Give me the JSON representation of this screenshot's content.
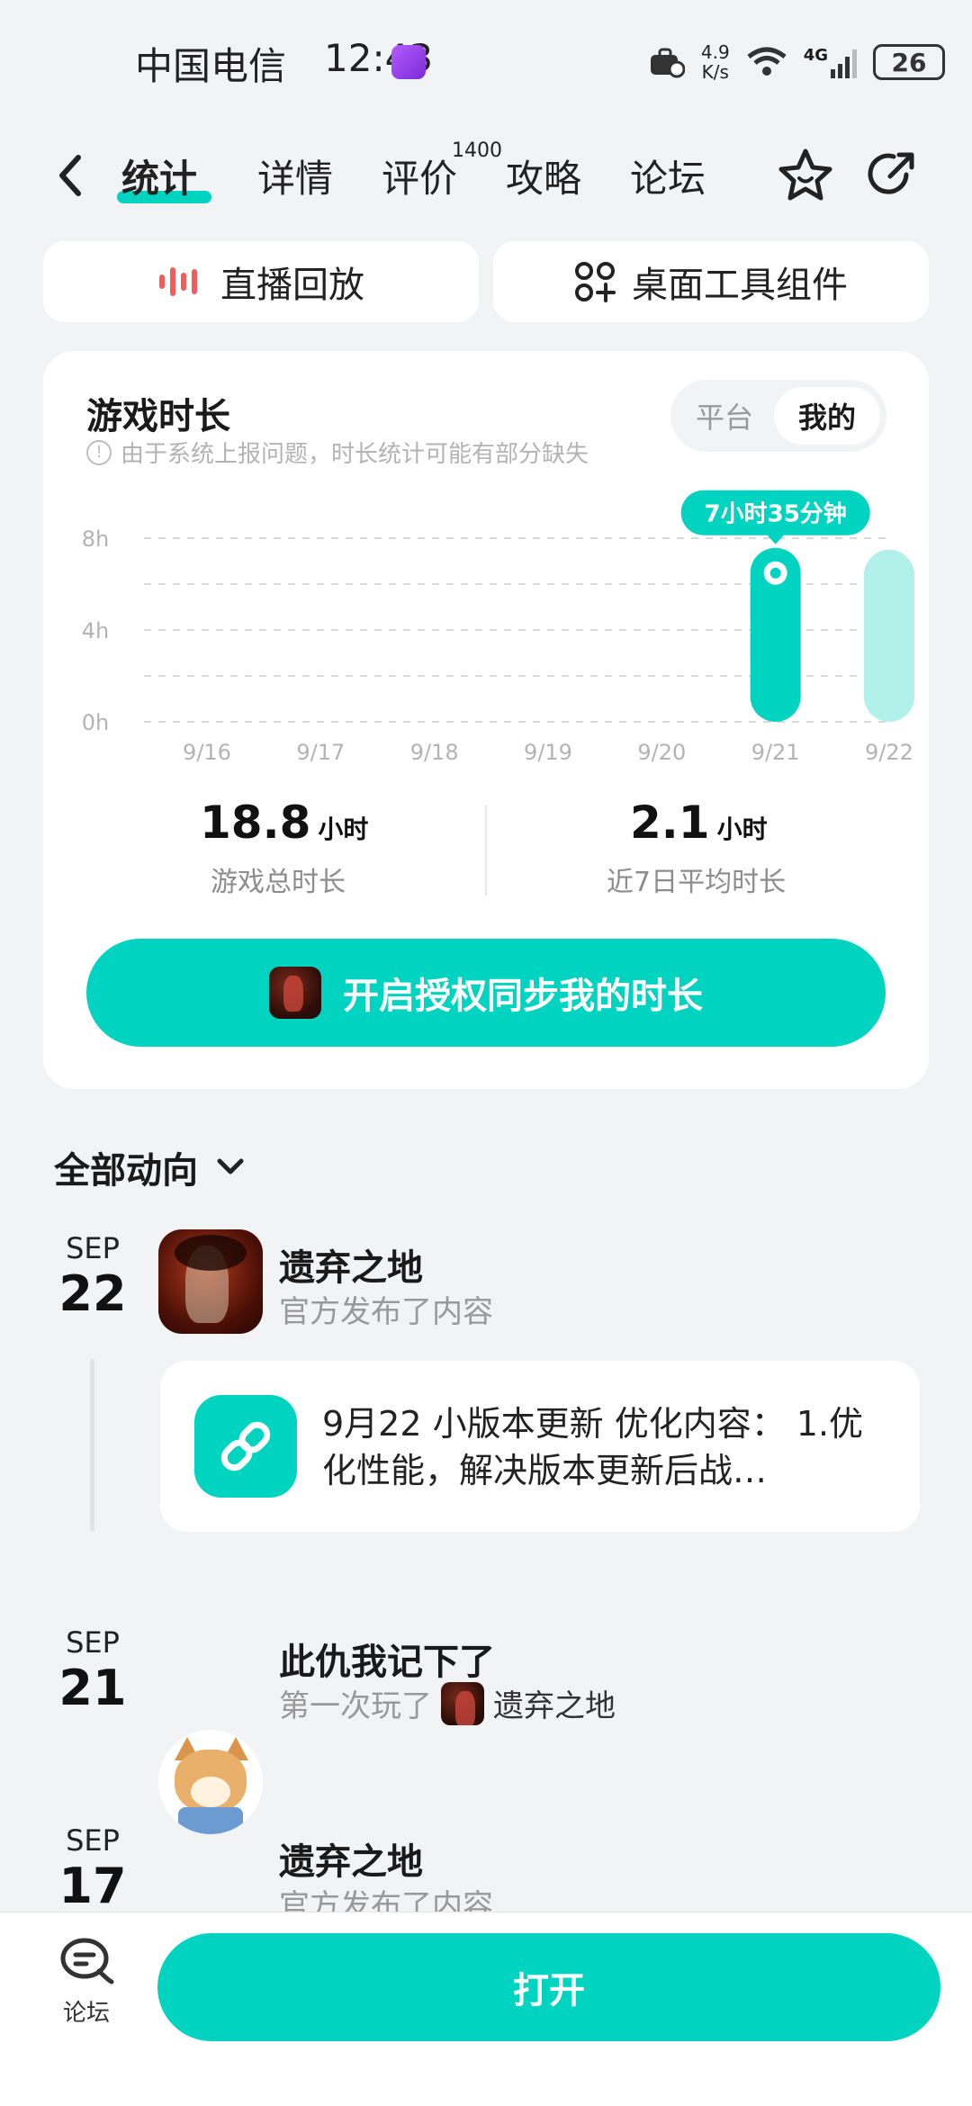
{
  "status_bar": {
    "carrier": "中国电信",
    "time": "12:43",
    "net_speed_top": "4.9",
    "net_speed_bottom": "K/s",
    "network": "4G",
    "battery": "26"
  },
  "nav": {
    "tabs": [
      {
        "label": "统计",
        "active": true
      },
      {
        "label": "详情",
        "active": false
      },
      {
        "label": "评价",
        "active": false,
        "badge": "1400"
      },
      {
        "label": "攻略",
        "active": false
      },
      {
        "label": "论坛",
        "active": false
      }
    ]
  },
  "quick_actions": {
    "replay": "直播回放",
    "widget": "桌面工具组件"
  },
  "playtime_card": {
    "title": "游戏时长",
    "note": "由于系统上报问题，时长统计可能有部分缺失",
    "segment": {
      "off": "平台",
      "on": "我的"
    },
    "tooltip": "7小时35分钟",
    "total_value": "18.8",
    "total_unit": "小时",
    "total_label": "游戏总时长",
    "avg_value": "2.1",
    "avg_unit": "小时",
    "avg_label": "近7日平均时长",
    "sync_button": "开启授权同步我的时长"
  },
  "chart_data": {
    "type": "bar",
    "categories": [
      "9/16",
      "9/17",
      "9/18",
      "9/19",
      "9/20",
      "9/21",
      "9/22"
    ],
    "values": [
      0,
      0,
      0,
      0,
      0,
      7.58,
      7.5
    ],
    "y_ticks": [
      "0h",
      "4h",
      "8h"
    ],
    "ylim": [
      0,
      8
    ],
    "grid": true,
    "colors": {
      "bar": "#00d4c0",
      "bar_light": "#b2f0ea",
      "grid": "#d9d9d9",
      "tick": "#b3b3b3"
    }
  },
  "activity": {
    "section_title": "全部动向",
    "items": [
      {
        "month": "SEP",
        "day": "22",
        "name": "遗弃之地",
        "sub": "官方发布了内容",
        "post": "9月22 小版本更新 优化内容： 1.优化性能，解决版本更新后战…"
      },
      {
        "month": "SEP",
        "day": "21",
        "name": "此仇我记下了",
        "sub": "第一次玩了",
        "game": "遗弃之地"
      },
      {
        "month": "SEP",
        "day": "17",
        "name": "遗弃之地",
        "sub": "官方发布了内容"
      }
    ]
  },
  "bottom_bar": {
    "forum_label": "论坛",
    "open_button": "打开"
  },
  "accent_color": "#00d4c0"
}
